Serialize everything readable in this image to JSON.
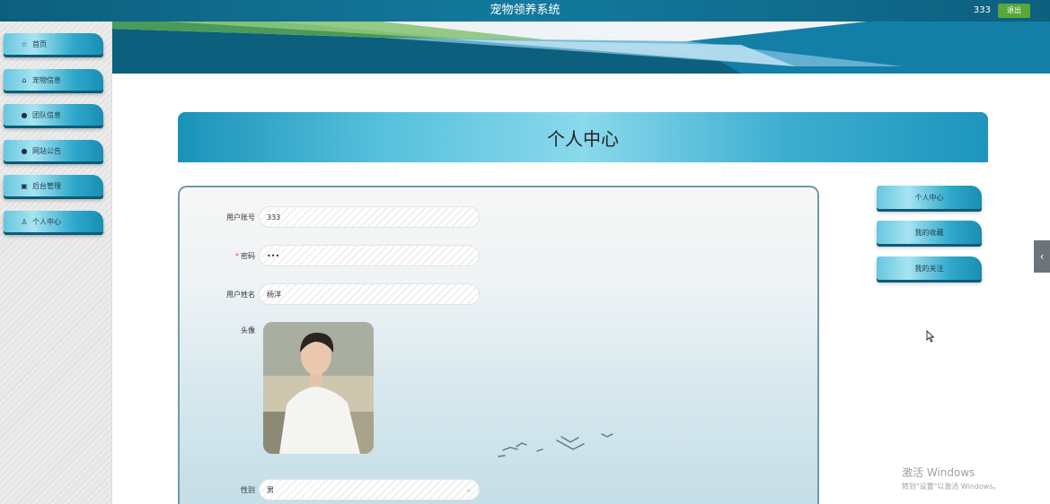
{
  "header": {
    "title": "宠物领养系统",
    "username": "333",
    "logout_label": "退出"
  },
  "sidebar": {
    "items": [
      {
        "icon": "star-icon",
        "glyph": "☆",
        "label": "首页"
      },
      {
        "icon": "home-icon",
        "glyph": "⌂",
        "label": "宠物信息"
      },
      {
        "icon": "info-icon",
        "glyph": "●",
        "label": "团队信息"
      },
      {
        "icon": "notice-icon",
        "glyph": "●",
        "label": "网站公告"
      },
      {
        "icon": "briefcase-icon",
        "glyph": "▣",
        "label": "后台管理"
      },
      {
        "icon": "user-icon",
        "glyph": "♙",
        "label": "个人中心"
      }
    ]
  },
  "page": {
    "title": "个人中心"
  },
  "form": {
    "account": {
      "label": "用户账号",
      "value": "333"
    },
    "password": {
      "required_mark": "*",
      "label": "密码",
      "value": "•••"
    },
    "name": {
      "label": "用户姓名",
      "value": "杨洋"
    },
    "avatar": {
      "label": "头像"
    },
    "gender": {
      "label": "性别",
      "value": "男"
    }
  },
  "right_menu": {
    "items": [
      "个人中心",
      "我的收藏",
      "我的关注"
    ]
  },
  "watermark": {
    "line1": "激活 Windows",
    "line2": "转到\"设置\"以激活 Windows。"
  },
  "colors": {
    "accent": "#2fa9cb",
    "topbar": "#137a9d",
    "logout": "#58a73a"
  }
}
